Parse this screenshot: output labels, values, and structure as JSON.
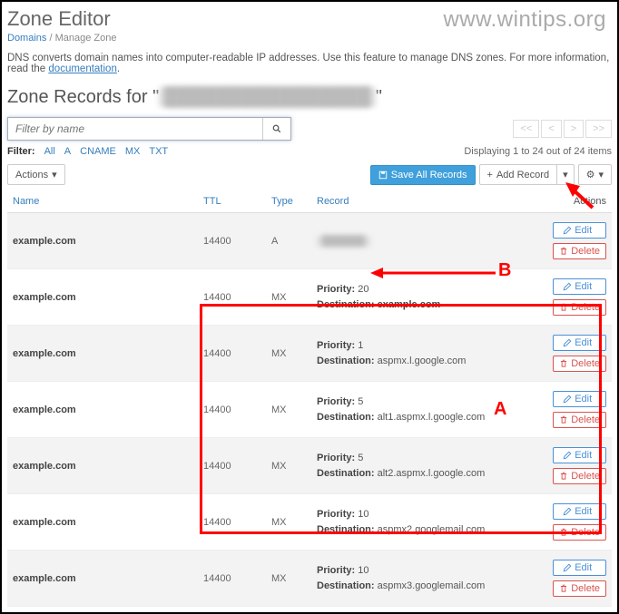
{
  "watermark": "www.wintips.org",
  "page_title": "Zone Editor",
  "breadcrumb": {
    "root": "Domains",
    "current": "Manage Zone"
  },
  "description_prefix": "DNS converts domain names into computer-readable IP addresses. Use this feature to manage DNS zones. For more information, read the ",
  "description_link": "documentation",
  "section_title_prefix": "Zone Records for \"",
  "section_title_suffix": "\"",
  "search": {
    "placeholder": "Filter by name"
  },
  "pager": {
    "first": "<<",
    "prev": "<",
    "next": ">",
    "last": ">>"
  },
  "filter": {
    "label": "Filter:",
    "items": [
      "All",
      "A",
      "CNAME",
      "MX",
      "TXT"
    ]
  },
  "displaying": "Displaying 1 to 24 out of 24 items",
  "toolbar": {
    "actions": "Actions",
    "save_all": "Save All Records",
    "add_record": "Add Record"
  },
  "columns": {
    "name": "Name",
    "ttl": "TTL",
    "type": "Type",
    "record": "Record",
    "actions": "Actions"
  },
  "labels": {
    "priority": "Priority:",
    "destination": "Destination:",
    "edit": "Edit",
    "delete": "Delete"
  },
  "rows": [
    {
      "name": "example.com",
      "ttl": "14400",
      "type": "A",
      "record_plain": "██████",
      "priority": null,
      "destination": null
    },
    {
      "name": "example.com",
      "ttl": "14400",
      "type": "MX",
      "priority": "20",
      "destination": "example.com"
    },
    {
      "name": "example.com",
      "ttl": "14400",
      "type": "MX",
      "priority": "1",
      "destination": "aspmx.l.google.com"
    },
    {
      "name": "example.com",
      "ttl": "14400",
      "type": "MX",
      "priority": "5",
      "destination": "alt1.aspmx.l.google.com"
    },
    {
      "name": "example.com",
      "ttl": "14400",
      "type": "MX",
      "priority": "5",
      "destination": "alt2.aspmx.l.google.com"
    },
    {
      "name": "example.com",
      "ttl": "14400",
      "type": "MX",
      "priority": "10",
      "destination": "aspmx2.googlemail.com"
    },
    {
      "name": "example.com",
      "ttl": "14400",
      "type": "MX",
      "priority": "10",
      "destination": "aspmx3.googlemail.com"
    }
  ],
  "annotations": {
    "a": "A",
    "b": "B"
  }
}
